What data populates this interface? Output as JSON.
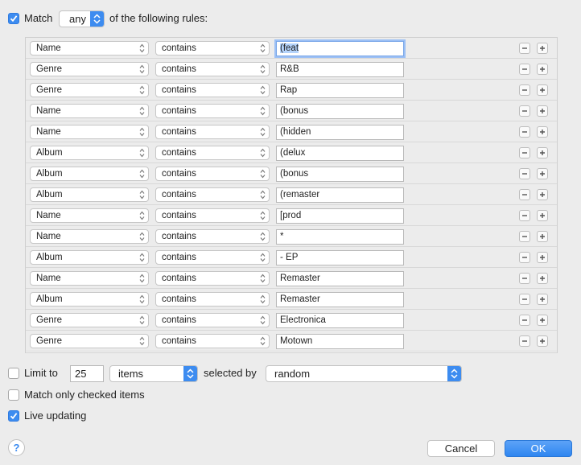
{
  "header": {
    "match_checked": true,
    "match_label": "Match",
    "match_mode": "any",
    "suffix": "of the following rules:"
  },
  "rules": [
    {
      "field": "Name",
      "operator": "contains",
      "value": "(feat"
    },
    {
      "field": "Genre",
      "operator": "contains",
      "value": "R&B"
    },
    {
      "field": "Genre",
      "operator": "contains",
      "value": "Rap"
    },
    {
      "field": "Name",
      "operator": "contains",
      "value": "(bonus"
    },
    {
      "field": "Name",
      "operator": "contains",
      "value": "(hidden"
    },
    {
      "field": "Album",
      "operator": "contains",
      "value": "(delux"
    },
    {
      "field": "Album",
      "operator": "contains",
      "value": "(bonus"
    },
    {
      "field": "Album",
      "operator": "contains",
      "value": "(remaster"
    },
    {
      "field": "Name",
      "operator": "contains",
      "value": "[prod"
    },
    {
      "field": "Name",
      "operator": "contains",
      "value": "*"
    },
    {
      "field": "Album",
      "operator": "contains",
      "value": "- EP"
    },
    {
      "field": "Name",
      "operator": "contains",
      "value": "Remaster"
    },
    {
      "field": "Album",
      "operator": "contains",
      "value": "Remaster"
    },
    {
      "field": "Genre",
      "operator": "contains",
      "value": "Electronica"
    },
    {
      "field": "Genre",
      "operator": "contains",
      "value": "Motown"
    }
  ],
  "limit": {
    "checked": false,
    "label": "Limit to",
    "value": "25",
    "unit": "items",
    "selected_by_label": "selected by",
    "selected_by": "random"
  },
  "options": {
    "match_checked_only": {
      "checked": false,
      "label": "Match only checked items"
    },
    "live_updating": {
      "checked": true,
      "label": "Live updating"
    }
  },
  "footer": {
    "help": "?",
    "cancel": "Cancel",
    "ok": "OK"
  },
  "colors": {
    "accent": "#3d8cf0",
    "background": "#ececec"
  }
}
